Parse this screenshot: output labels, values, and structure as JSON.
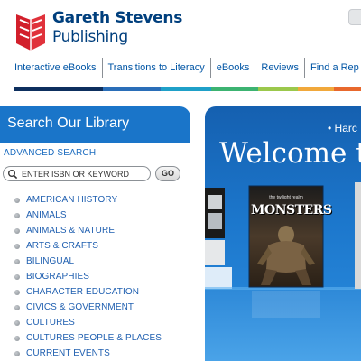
{
  "header": {
    "brand_line1": "Gareth Stevens",
    "brand_line2": "Publishing",
    "logo_icon": "book-logo-icon"
  },
  "nav": {
    "items": [
      "Interactive eBooks",
      "Transitions to Literacy",
      "eBooks",
      "Reviews",
      "Find a Rep"
    ]
  },
  "colors": {
    "brand_blue": "#003f7d",
    "accent_red": "#d21f2b",
    "panel_blue": "#1a75c9",
    "stripe": [
      "#0d2f5e",
      "#2a6eb8",
      "#1fa0c8",
      "#3cb371",
      "#9bc84c",
      "#f1a83b",
      "#e8682d"
    ]
  },
  "library": {
    "title": "Search Our Library",
    "advanced_search": "ADVANCED SEARCH",
    "search_placeholder": "ENTER ISBN OR KEYWORD",
    "go_label": "GO",
    "categories": [
      "AMERICAN HISTORY",
      "ANIMALS",
      "ANIMALS & NATURE",
      "ARTS & CRAFTS",
      "BILINGUAL",
      "BIOGRAPHIES",
      "CHARACTER EDUCATION",
      "CIVICS & GOVERNMENT",
      "CULTURES",
      "CULTURES PEOPLE & PLACES",
      "CURRENT EVENTS"
    ]
  },
  "hero": {
    "top_text": "• Harc",
    "welcome": "Welcome t",
    "book_series": "the twilight realm",
    "book_title": "MONSTERS"
  }
}
